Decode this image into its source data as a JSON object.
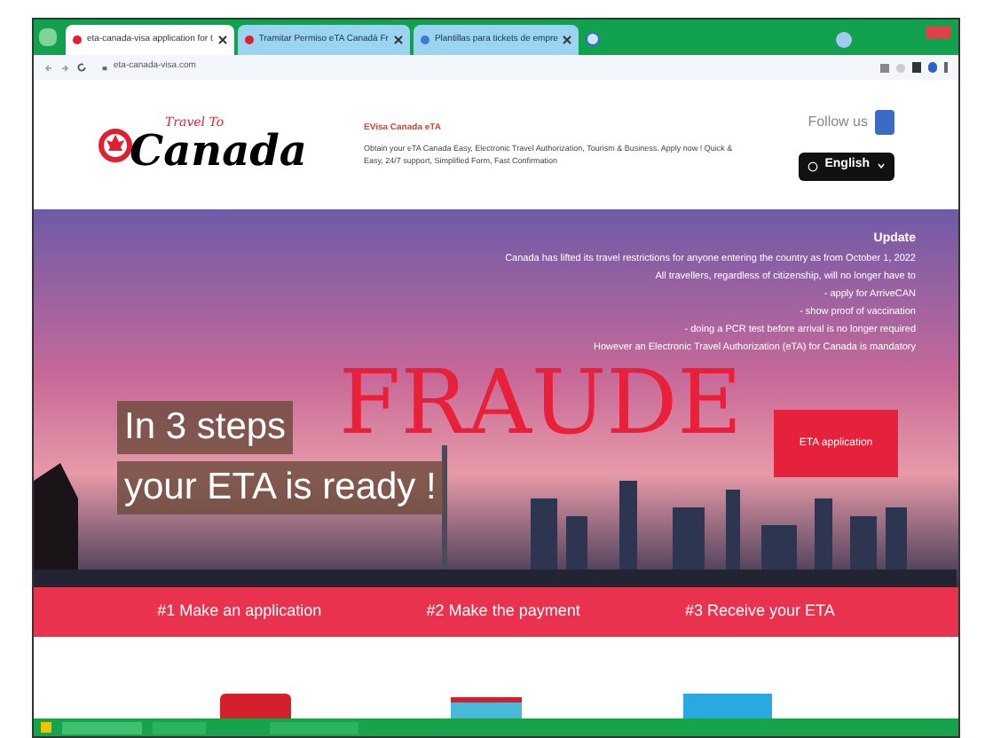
{
  "browser": {
    "tabs": [
      {
        "title": "eta-canada-visa application for t",
        "selected": true
      },
      {
        "title": "Tramitar Permiso eTA Canadá Fr",
        "selected": false
      },
      {
        "title": "Plantillas para tickets de empre",
        "selected": false
      }
    ],
    "url": "eta-canada-visa.com"
  },
  "header": {
    "logo_small": "Travel To",
    "logo_big": "Canada",
    "site_title": "EVisa Canada eTA",
    "description": "Obtain your eTA Canada Easy, Electronic Travel Authorization, Tourism & Business. Apply now ! Quick & Easy, 24/7 support, Simplified Form, Fast Confirmation",
    "follow": "Follow us",
    "language": "English"
  },
  "hero": {
    "update_title": "Update",
    "update_lines": [
      "Canada has lifted its travel restrictions for anyone entering the country as from October 1, 2022",
      "All travellers, regardless of citizenship, will no longer have to",
      "- apply for ArriveCAN",
      "- show proof of vaccination",
      "- doing a PCR test before arrival is no longer required",
      "However an Electronic Travel Authorization (eTA) for Canada is mandatory"
    ],
    "headline_1": "In 3 steps",
    "headline_2": "your ETA is ready !",
    "button": "ETA application",
    "stamp": "FRAUDE"
  },
  "steps": [
    "#1 Make an application",
    "#2 Make the payment",
    "#3 Receive your ETA"
  ]
}
